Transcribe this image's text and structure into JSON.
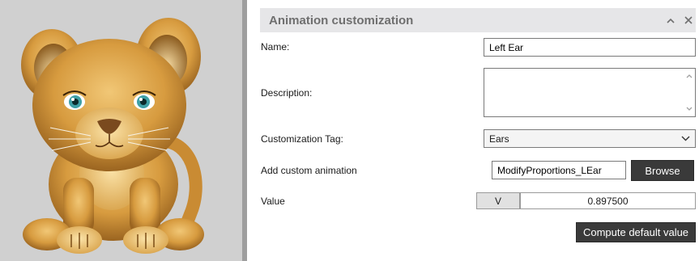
{
  "panel": {
    "title": "Animation customization",
    "collapse_icon": "chevron-up-icon",
    "close_icon": "close-icon"
  },
  "form": {
    "name_label": "Name:",
    "name_value": "Left Ear",
    "description_label": "Description:",
    "description_value": "",
    "tag_label": "Customization Tag:",
    "tag_value": "Ears",
    "custom_anim_label": "Add custom animation",
    "custom_anim_value": "ModifyProportions_LEar",
    "browse_label": "Browse",
    "value_label": "Value",
    "v_button_label": "V",
    "value": "0.897500",
    "compute_label": "Compute default value"
  },
  "colors": {
    "header_bg": "#e6e6e8",
    "header_text": "#6f6f6f",
    "dark_button": "#3a3a3a",
    "preview_bg": "#d0d0d0"
  }
}
